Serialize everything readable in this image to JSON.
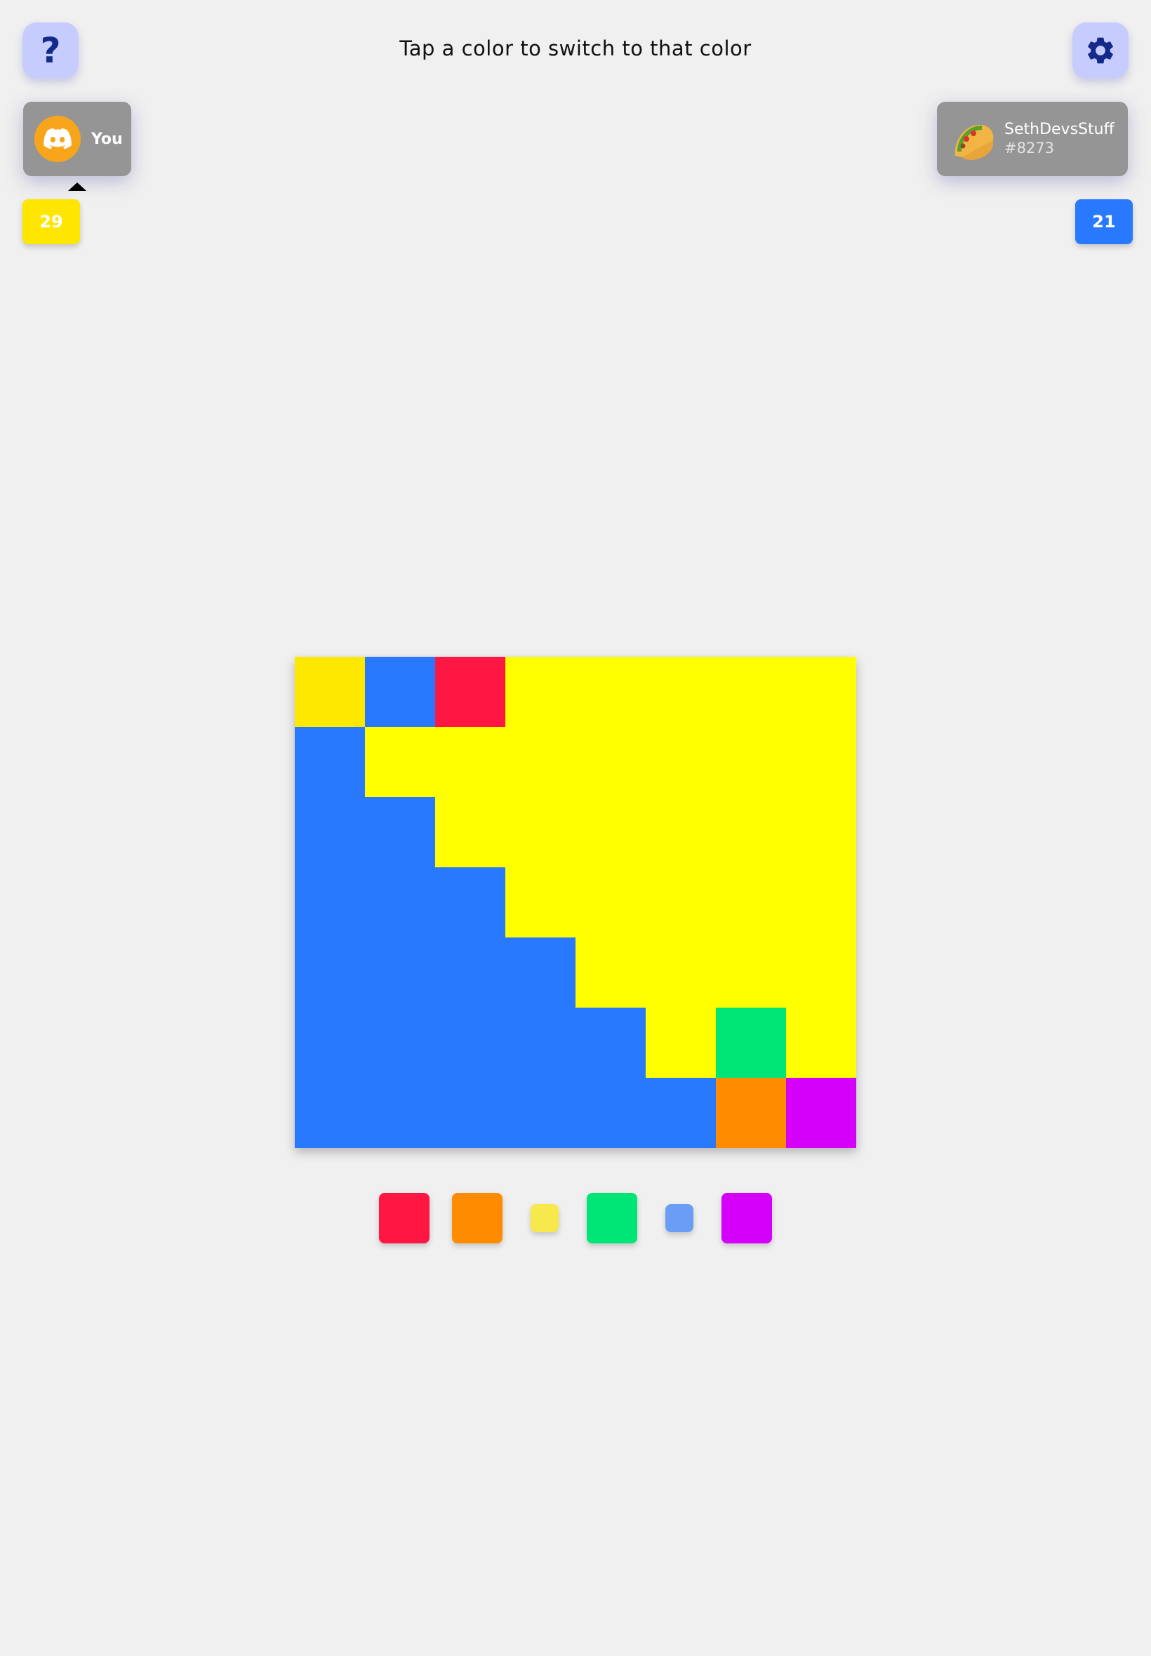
{
  "header": {
    "instruction": "Tap a color to switch to that color",
    "help_button": "?",
    "help_icon": "question-mark-icon",
    "settings_icon": "gear-icon"
  },
  "players": {
    "you": {
      "label": "You",
      "avatar_icon": "discord-logo-icon",
      "avatar_color": "#f7a61c",
      "score": "29",
      "color": "#ffe600",
      "active": true
    },
    "opponent": {
      "name": "SethDevsStuff",
      "tag": "#8273",
      "avatar_icon": "taco-icon",
      "score": "21",
      "color": "#2979ff"
    }
  },
  "board": {
    "columns": 8,
    "rows": 7,
    "palette": {
      "Y": "#ffff00",
      "y": "#ffe800",
      "B": "#2979ff",
      "R": "#ff1744",
      "G": "#00e676",
      "O": "#ff8c00",
      "P": "#d500f9"
    },
    "grid": [
      [
        "y",
        "B",
        "R",
        "Y",
        "Y",
        "Y",
        "Y",
        "Y"
      ],
      [
        "B",
        "Y",
        "Y",
        "Y",
        "Y",
        "Y",
        "Y",
        "Y"
      ],
      [
        "B",
        "B",
        "Y",
        "Y",
        "Y",
        "Y",
        "Y",
        "Y"
      ],
      [
        "B",
        "B",
        "B",
        "Y",
        "Y",
        "Y",
        "Y",
        "Y"
      ],
      [
        "B",
        "B",
        "B",
        "B",
        "Y",
        "Y",
        "Y",
        "Y"
      ],
      [
        "B",
        "B",
        "B",
        "B",
        "B",
        "Y",
        "G",
        "Y"
      ],
      [
        "B",
        "B",
        "B",
        "B",
        "B",
        "B",
        "O",
        "P"
      ]
    ]
  },
  "color_choices": [
    {
      "name": "red",
      "color": "#ff1744",
      "available": true
    },
    {
      "name": "orange",
      "color": "#ff8c00",
      "available": true
    },
    {
      "name": "yellow",
      "color": "#f7e84c",
      "available": false
    },
    {
      "name": "green",
      "color": "#00e676",
      "available": true
    },
    {
      "name": "blue",
      "color": "#6a9ef5",
      "available": false
    },
    {
      "name": "purple",
      "color": "#d500f9",
      "available": true
    }
  ]
}
